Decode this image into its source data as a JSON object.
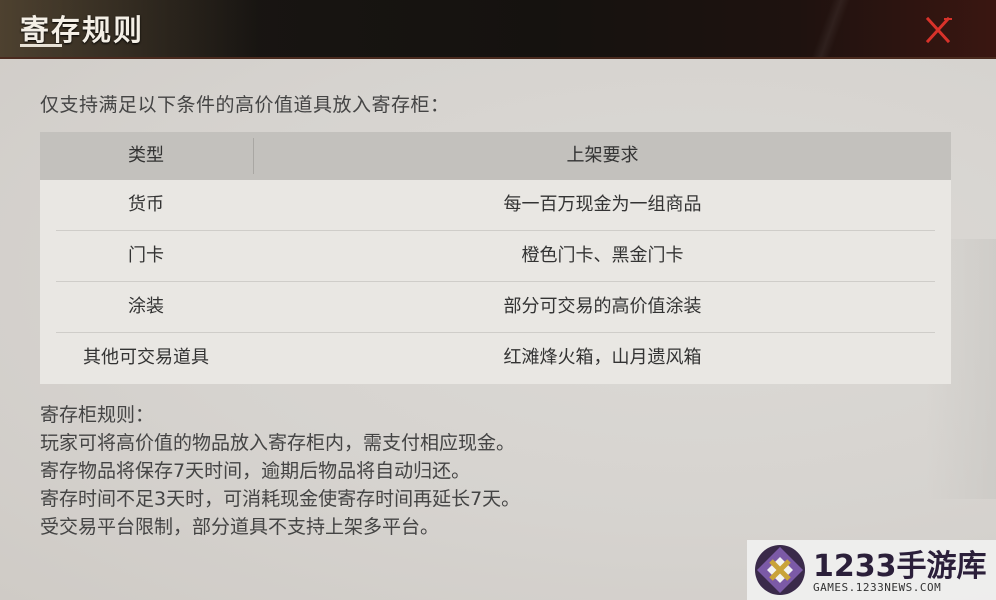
{
  "header": {
    "title": "寄存规则",
    "close_icon": "close-icon"
  },
  "intro": "仅支持满足以下条件的高价值道具放入寄存柜：",
  "table": {
    "columns": [
      "类型",
      "上架要求"
    ],
    "rows": [
      [
        "货币",
        "每一百万现金为一组商品"
      ],
      [
        "门卡",
        "橙色门卡、黑金门卡"
      ],
      [
        "涂装",
        "部分可交易的高价值涂装"
      ],
      [
        "其他可交易道具",
        "红滩烽火箱，山月遗风箱"
      ]
    ]
  },
  "rules": {
    "heading": "寄存柜规则：",
    "lines": [
      "玩家可将高价值的物品放入寄存柜内，需支付相应现金。",
      "寄存物品将保存7天时间，逾期后物品将自动归还。",
      "寄存时间不足3天时，可消耗现金使寄存时间再延长7天。",
      "受交易平台限制，部分道具不支持上架多平台。"
    ]
  },
  "watermark": {
    "brand": "1233手游库",
    "site": "GAMES.1233NEWS.COM"
  },
  "colors": {
    "close_accent": "#d8322a",
    "header_bg": "#15120f",
    "table_header_bg": "#c3c1bd"
  }
}
